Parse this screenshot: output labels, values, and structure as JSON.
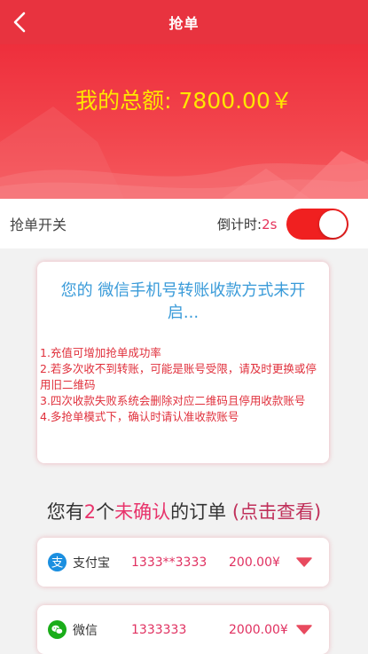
{
  "header": {
    "title": "抢单"
  },
  "summary": {
    "total_label": "我的总额: 7800.00￥"
  },
  "switch_row": {
    "label": "抢单开关",
    "countdown_label": "倒计时:",
    "countdown_value": "2s",
    "toggle_on": true
  },
  "notice": {
    "headline": "您的 微信手机号转账收款方式未开启...",
    "rules": [
      "1.充值可增加抢单成功率",
      "2.若多次收不到转账，可能是账号受限，请及时更换或停用旧二维码",
      "3.四次收款失败系统会删除对应二维码且停用收款账号",
      "4.多抢单模式下，确认时请认准收款账号"
    ]
  },
  "orders": {
    "title_prefix": "您有",
    "count": "2",
    "title_mid": "个",
    "unconfirmed": "未确认",
    "title_suffix": "的订单",
    "view_link": "(点击查看)",
    "items": [
      {
        "method": "支付宝",
        "account": "1333**3333",
        "amount": "200.00¥",
        "icon": "alipay-icon",
        "icon_color": "#1b8fe0"
      },
      {
        "method": "微信",
        "account": "1333333",
        "amount": "2000.00¥",
        "icon": "wechat-icon",
        "icon_color": "#1aad19"
      }
    ]
  },
  "colors": {
    "primary_red": "#e8333f",
    "total_yellow": "#ffe600",
    "notice_blue": "#3a9bd9",
    "accent_pink": "#e8336b"
  }
}
